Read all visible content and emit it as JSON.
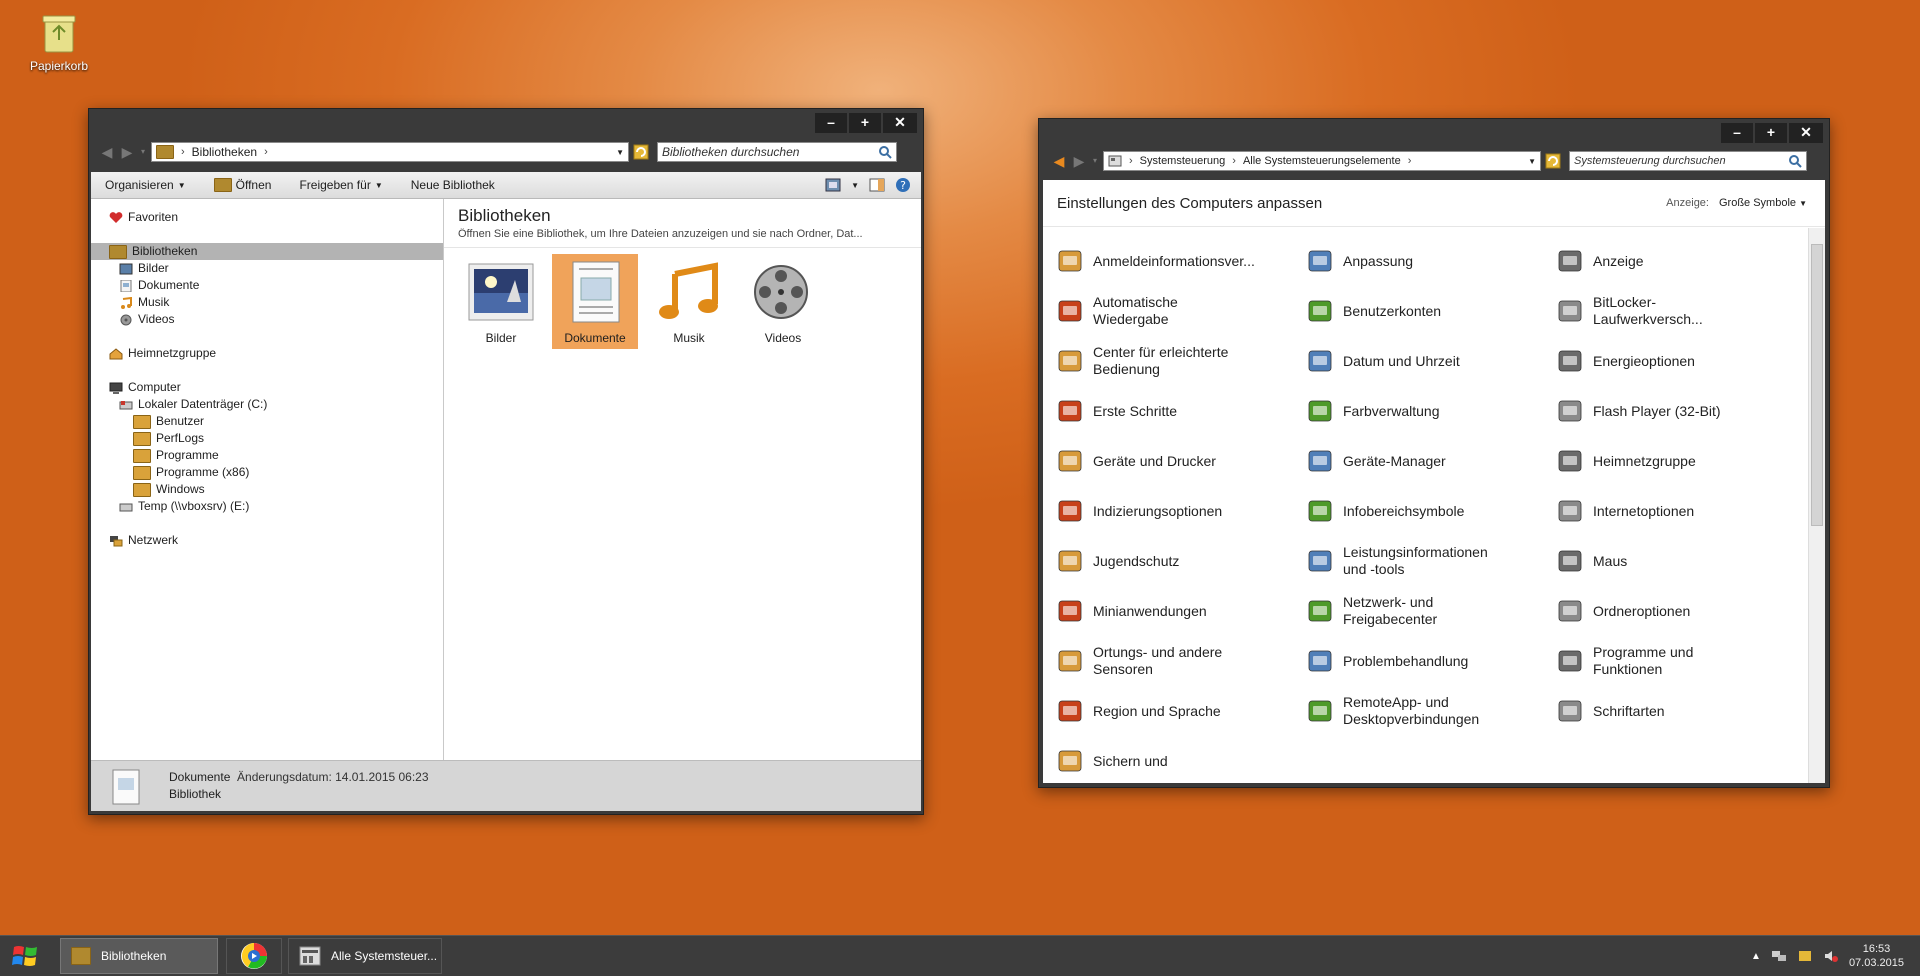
{
  "desktop": {
    "recycle_bin_label": "Papierkorb"
  },
  "explorer": {
    "address": "Bibliotheken",
    "search_placeholder": "Bibliotheken durchsuchen",
    "toolbar": {
      "organize": "Organisieren",
      "open": "Öffnen",
      "share": "Freigeben für",
      "new_library": "Neue Bibliothek"
    },
    "nav": {
      "favorites": "Favoriten",
      "libraries": "Bibliotheken",
      "lib_items": [
        "Bilder",
        "Dokumente",
        "Musik",
        "Videos"
      ],
      "homegroup": "Heimnetzgruppe",
      "computer": "Computer",
      "drive_c": "Lokaler Datenträger (C:)",
      "c_folders": [
        "Benutzer",
        "PerfLogs",
        "Programme",
        "Programme (x86)",
        "Windows"
      ],
      "drive_e": "Temp (\\\\vboxsrv) (E:)",
      "network": "Netzwerk"
    },
    "content": {
      "title": "Bibliotheken",
      "subtitle": "Öffnen Sie eine Bibliothek, um Ihre Dateien anzuzeigen und sie nach Ordner, Dat...",
      "libraries": [
        "Bilder",
        "Dokumente",
        "Musik",
        "Videos"
      ],
      "selected": "Dokumente"
    },
    "status": {
      "name": "Dokumente",
      "modified": "Änderungsdatum: 14.01.2015 06:23",
      "type": "Bibliothek"
    }
  },
  "controlpanel": {
    "breadcrumb": [
      "Systemsteuerung",
      "Alle Systemsteuerungselemente"
    ],
    "search_placeholder": "Systemsteuerung durchsuchen",
    "heading": "Einstellungen des Computers anpassen",
    "view_label": "Anzeige:",
    "view_value": "Große Symbole",
    "items": [
      [
        "Anmeldeinformationsver...",
        "Anpassung",
        "Anzeige"
      ],
      [
        "Automatische Wiedergabe",
        "Benutzerkonten",
        "BitLocker-Laufwerkversch..."
      ],
      [
        "Center für erleichterte Bedienung",
        "Datum und Uhrzeit",
        "Energieoptionen"
      ],
      [
        "Erste Schritte",
        "Farbverwaltung",
        "Flash Player (32-Bit)"
      ],
      [
        "Geräte und Drucker",
        "Geräte-Manager",
        "Heimnetzgruppe"
      ],
      [
        "Indizierungsoptionen",
        "Infobereichsymbole",
        "Internetoptionen"
      ],
      [
        "Jugendschutz",
        "Leistungsinformationen und -tools",
        "Maus"
      ],
      [
        "Minianwendungen",
        "Netzwerk- und Freigabecenter",
        "Ordneroptionen"
      ],
      [
        "Ortungs- und andere Sensoren",
        "Problembehandlung",
        "Programme und Funktionen"
      ],
      [
        "Region und Sprache",
        "RemoteApp- und Desktopverbindungen",
        "Schriftarten"
      ],
      [
        "Sichern und",
        "",
        ""
      ]
    ],
    "icon_colors": [
      "#d79a3b",
      "#4f7fb8",
      "#6b6b6b",
      "#c7401a",
      "#4e9a2a",
      "#8a8a8a"
    ]
  },
  "taskbar": {
    "explorer_label": "Bibliotheken",
    "cp_label": "Alle Systemsteuer...",
    "time": "16:53",
    "date": "07.03.2015"
  }
}
